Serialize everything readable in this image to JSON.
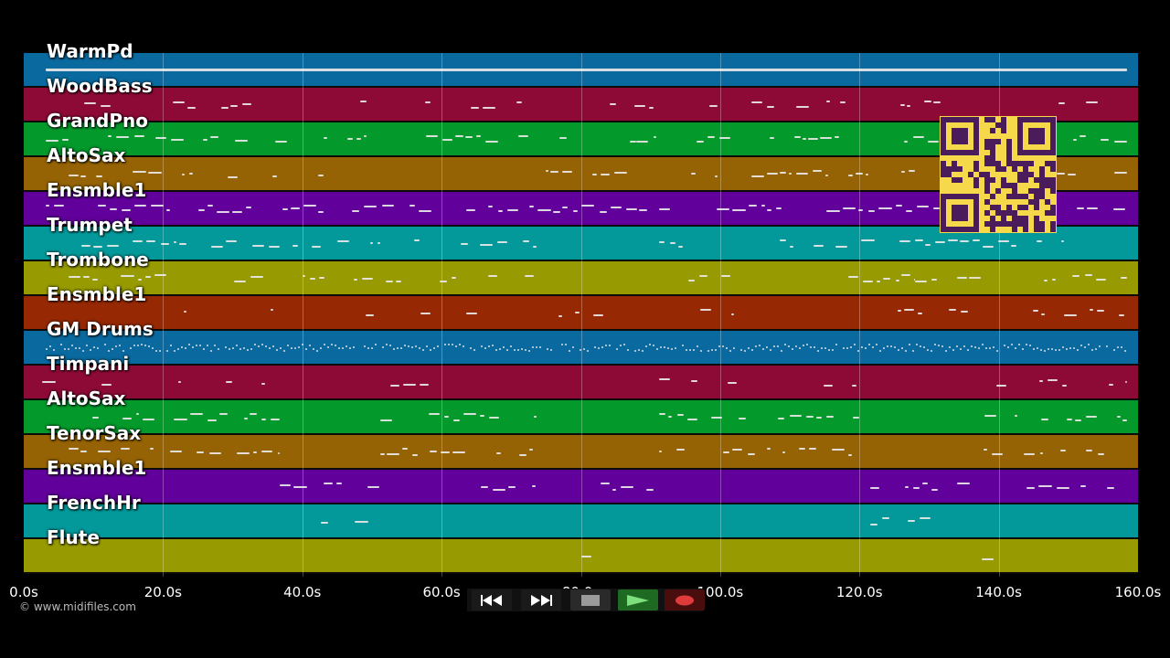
{
  "tracks": [
    {
      "name": "WarmPd",
      "color": "#0a6aa0"
    },
    {
      "name": "WoodBass",
      "color": "#8e0a36"
    },
    {
      "name": "GrandPno",
      "color": "#03992b"
    },
    {
      "name": "AltoSax",
      "color": "#966304"
    },
    {
      "name": "Ensmble1",
      "color": "#61009a"
    },
    {
      "name": "Trumpet",
      "color": "#03999a"
    },
    {
      "name": "Trombone",
      "color": "#989a02"
    },
    {
      "name": "Ensmble1",
      "color": "#962903"
    },
    {
      "name": "GM Drums",
      "color": "#0a6aa0"
    },
    {
      "name": "Timpani",
      "color": "#8e0a36"
    },
    {
      "name": "AltoSax",
      "color": "#03992b"
    },
    {
      "name": "TenorSax",
      "color": "#966304"
    },
    {
      "name": "Ensmble1",
      "color": "#61009a"
    },
    {
      "name": "FrenchHr",
      "color": "#03999a"
    },
    {
      "name": "Flute",
      "color": "#989a02"
    }
  ],
  "timeline": {
    "ticks": [
      "0.0s",
      "20.0s",
      "40.0s",
      "60.0s",
      "80.0s",
      "100.0s",
      "120.0s",
      "140.0s",
      "160.0s"
    ]
  },
  "footer": {
    "copyright": "© www.midifiles.com"
  },
  "controls": [
    {
      "icon": "rewind-icon"
    },
    {
      "icon": "fast-forward-icon"
    },
    {
      "icon": "stop-icon"
    },
    {
      "icon": "play-icon"
    },
    {
      "icon": "record-icon"
    }
  ],
  "colors": {
    "background": "#000000",
    "note": "#e8e8e8",
    "qr_background": "#f5d94a",
    "qr_module": "#4a1c5c"
  }
}
